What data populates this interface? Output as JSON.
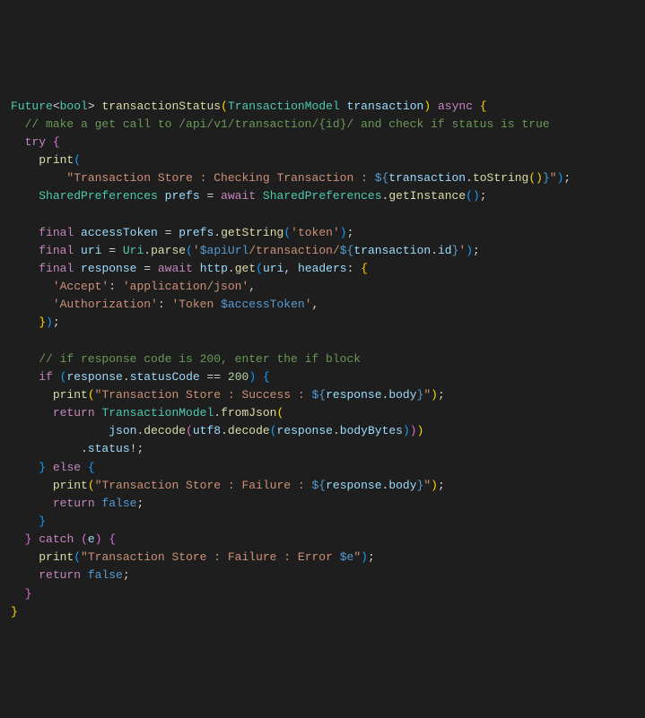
{
  "code": {
    "line1": {
      "p1": "Future",
      "p2": "<",
      "p3": "bool",
      "p4": ">",
      "p5": " ",
      "p6": "transactionStatus",
      "p7": "(",
      "p8": "TransactionModel",
      "p9": " ",
      "p10": "transaction",
      "p11": ")",
      "p12": " ",
      "p13": "async",
      "p14": " ",
      "p15": "{"
    },
    "line2": "  // make a get call to /api/v1/transaction/{id}/ and check if status is true",
    "line3": {
      "p1": "  ",
      "p2": "try",
      "p3": " ",
      "p4": "{"
    },
    "line4": {
      "p1": "    ",
      "p2": "print",
      "p3": "("
    },
    "line5": {
      "p1": "        ",
      "p2": "\"Transaction Store : Checking Transaction : ",
      "p3": "${",
      "p4": "transaction",
      "p5": ".",
      "p6": "toString",
      "p7": "()",
      "p8": "}",
      "p9": "\"",
      "p10": ")",
      "p11": ";"
    },
    "line6": {
      "p1": "    ",
      "p2": "SharedPreferences",
      "p3": " ",
      "p4": "prefs",
      "p5": " = ",
      "p6": "await",
      "p7": " ",
      "p8": "SharedPreferences",
      "p9": ".",
      "p10": "getInstance",
      "p11": "()",
      "p12": ";"
    },
    "line7": "",
    "line8": {
      "p1": "    ",
      "p2": "final",
      "p3": " ",
      "p4": "accessToken",
      "p5": " = ",
      "p6": "prefs",
      "p7": ".",
      "p8": "getString",
      "p9": "(",
      "p10": "'token'",
      "p11": ")",
      "p12": ";"
    },
    "line9": {
      "p1": "    ",
      "p2": "final",
      "p3": " ",
      "p4": "uri",
      "p5": " = ",
      "p6": "Uri",
      "p7": ".",
      "p8": "parse",
      "p9": "(",
      "p10": "'",
      "p11": "$apiUrl",
      "p12": "/transaction/",
      "p13": "${",
      "p14": "transaction",
      "p15": ".",
      "p16": "id",
      "p17": "}",
      "p18": "'",
      "p19": ")",
      "p20": ";"
    },
    "line10": {
      "p1": "    ",
      "p2": "final",
      "p3": " ",
      "p4": "response",
      "p5": " = ",
      "p6": "await",
      "p7": " ",
      "p8": "http",
      "p9": ".",
      "p10": "get",
      "p11": "(",
      "p12": "uri",
      "p13": ", ",
      "p14": "headers",
      "p15": ": ",
      "p16": "{"
    },
    "line11": {
      "p1": "      ",
      "p2": "'Accept'",
      "p3": ": ",
      "p4": "'application/json'",
      "p5": ","
    },
    "line12": {
      "p1": "      ",
      "p2": "'Authorization'",
      "p3": ": ",
      "p4": "'Token ",
      "p5": "$accessToken",
      "p6": "'",
      "p7": ","
    },
    "line13": {
      "p1": "    ",
      "p2": "}",
      "p3": ")",
      "p4": ";"
    },
    "line14": "",
    "line15": "    // if response code is 200, enter the if block",
    "line16": {
      "p1": "    ",
      "p2": "if",
      "p3": " ",
      "p4": "(",
      "p5": "response",
      "p6": ".",
      "p7": "statusCode",
      "p8": " == ",
      "p9": "200",
      "p10": ")",
      "p11": " ",
      "p12": "{"
    },
    "line17": {
      "p1": "      ",
      "p2": "print",
      "p3": "(",
      "p4": "\"Transaction Store : Success : ",
      "p5": "${",
      "p6": "response",
      "p7": ".",
      "p8": "body",
      "p9": "}",
      "p10": "\"",
      "p11": ")",
      "p12": ";"
    },
    "line18": {
      "p1": "      ",
      "p2": "return",
      "p3": " ",
      "p4": "TransactionModel",
      "p5": ".",
      "p6": "fromJson",
      "p7": "("
    },
    "line19": {
      "p1": "              ",
      "p2": "json",
      "p3": ".",
      "p4": "decode",
      "p5": "(",
      "p6": "utf8",
      "p7": ".",
      "p8": "decode",
      "p9": "(",
      "p10": "response",
      "p11": ".",
      "p12": "bodyBytes",
      "p13": ")",
      "p14": ")",
      "p15": ")"
    },
    "line20": {
      "p1": "          .",
      "p2": "status",
      "p3": "!;"
    },
    "line21": {
      "p1": "    ",
      "p2": "}",
      "p3": " ",
      "p4": "else",
      "p5": " ",
      "p6": "{"
    },
    "line22": {
      "p1": "      ",
      "p2": "print",
      "p3": "(",
      "p4": "\"Transaction Store : Failure : ",
      "p5": "${",
      "p6": "response",
      "p7": ".",
      "p8": "body",
      "p9": "}",
      "p10": "\"",
      "p11": ")",
      "p12": ";"
    },
    "line23": {
      "p1": "      ",
      "p2": "return",
      "p3": " ",
      "p4": "false",
      "p5": ";"
    },
    "line24": {
      "p1": "    ",
      "p2": "}"
    },
    "line25": {
      "p1": "  ",
      "p2": "}",
      "p3": " ",
      "p4": "catch",
      "p5": " ",
      "p6": "(",
      "p7": "e",
      "p8": ")",
      "p9": " ",
      "p10": "{"
    },
    "line26": {
      "p1": "    ",
      "p2": "print",
      "p3": "(",
      "p4": "\"Transaction Store : Failure : Error ",
      "p5": "$e",
      "p6": "\"",
      "p7": ")",
      "p8": ";"
    },
    "line27": {
      "p1": "    ",
      "p2": "return",
      "p3": " ",
      "p4": "false",
      "p5": ";"
    },
    "line28": {
      "p1": "  ",
      "p2": "}"
    },
    "line29": {
      "p1": "}"
    }
  }
}
